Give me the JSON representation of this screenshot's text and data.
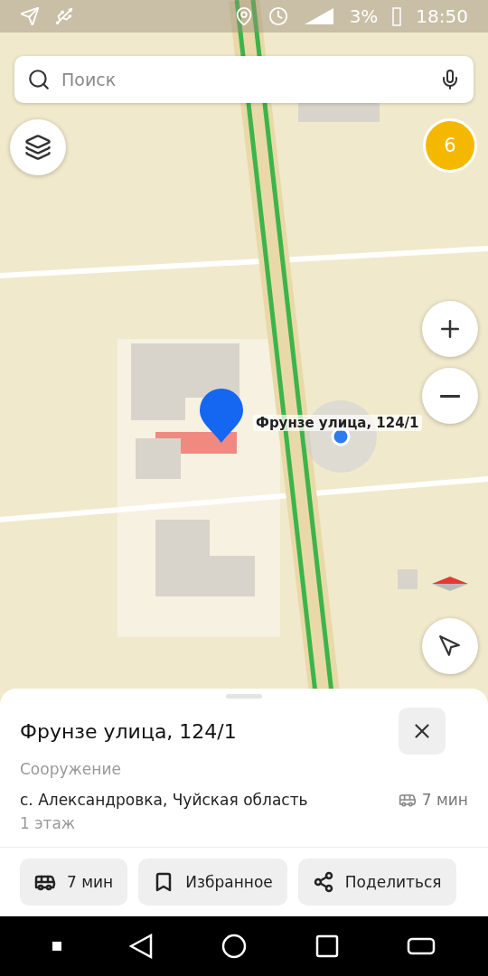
{
  "status_bar": {
    "battery": "3%",
    "time": "18:50"
  },
  "search": {
    "placeholder": "Поиск"
  },
  "traffic_badge": "6",
  "map": {
    "pin_label": "Фрунзе улица, 124/1"
  },
  "place": {
    "title": "Фрунзе улица, 124/1",
    "category": "Сооружение",
    "address": "с. Александровка, Чуйская область",
    "transit_time": "7 мин",
    "floors": "1 этаж"
  },
  "actions": [
    {
      "kind": "route",
      "label": "7 мин"
    },
    {
      "kind": "bookmark",
      "label": "Избранное"
    },
    {
      "kind": "share",
      "label": "Поделиться"
    }
  ]
}
